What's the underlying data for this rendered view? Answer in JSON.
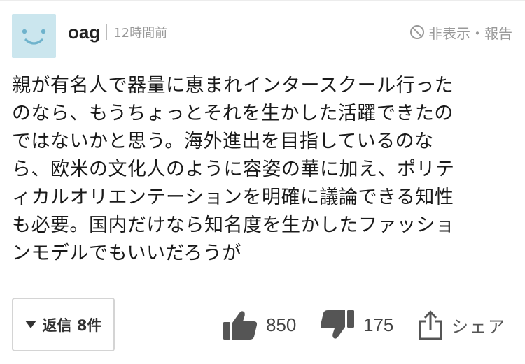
{
  "comment": {
    "username": "oag",
    "time": "12時間前",
    "report_label": "非表示・報告",
    "body_lines": [
      "親が有名人で器量に恵まれインタースクール行った",
      "のなら、もうちょっとそれを生かした活躍できたの",
      "ではないかと思う。海外進出を目指しているのな",
      "ら、欧米の文化人のように容姿の華に加え、ポリテ",
      "ィカルオリエンテーションを明確に議論できる知性",
      "も必要。国内だけなら知名度を生かしたファッショ",
      "ンモデルでもいいだろうが"
    ]
  },
  "actions": {
    "reply_label": "返信 8件",
    "like_count": "850",
    "dislike_count": "175",
    "share_label": "シェア"
  },
  "icons": {
    "avatar": "smiley-face-avatar",
    "report": "prohibited-icon",
    "like": "thumbs-up-icon",
    "dislike": "thumbs-down-icon",
    "share": "share-upload-icon",
    "reply": "triangle-down-icon"
  },
  "colors": {
    "avatar_bg": "#cbe6ee",
    "avatar_face": "#6fb3cc",
    "icon_gray": "#555555",
    "muted_text": "#999999"
  }
}
